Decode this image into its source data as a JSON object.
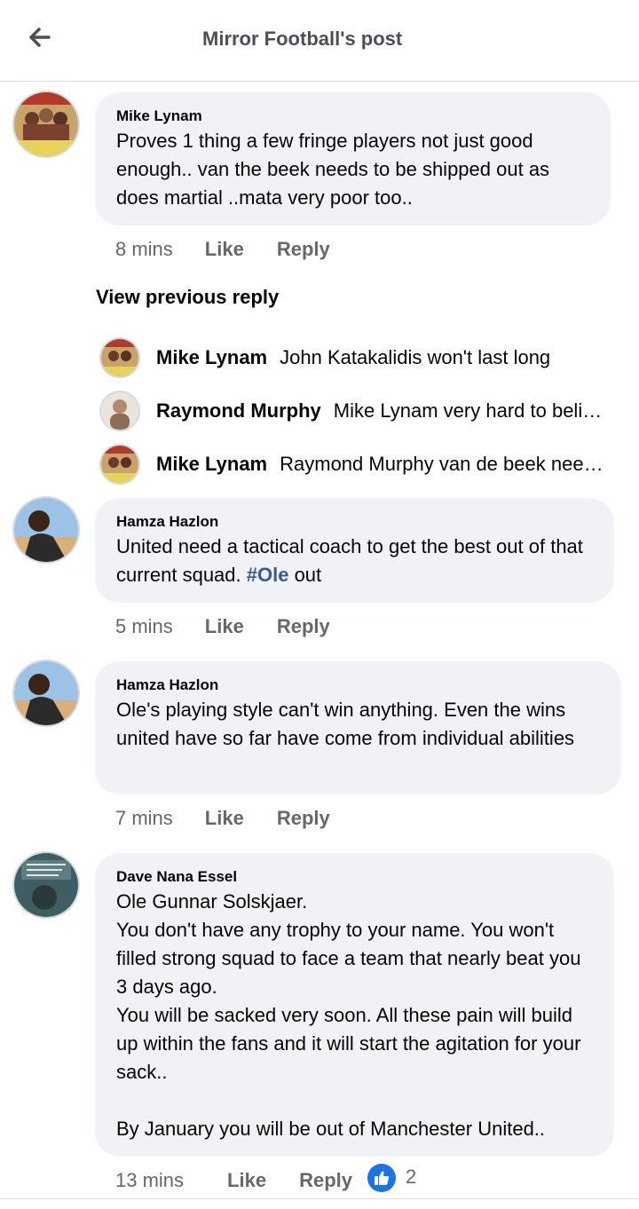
{
  "header": {
    "title": "Mirror Football's post",
    "back_icon": "arrow-left-icon"
  },
  "colors": {
    "bubble": "#f0f2f5",
    "meta": "#65676b",
    "hashtag": "#385898",
    "like_blue": "#1b74e4"
  },
  "comments": [
    {
      "author": "Mike Lynam",
      "text": "Proves 1 thing a few fringe players not just good enough.. van the beek  needs to be shipped out as does martial  ..mata very poor too..",
      "time": "8 mins",
      "like": "Like",
      "reply": "Reply"
    },
    {
      "author": "Hamza Hazlon",
      "text_before": "United need a tactical coach to get the best out of that current squad. ",
      "hashtag": "#Ole",
      "text_after": " out",
      "time": "5 mins",
      "like": "Like",
      "reply": "Reply"
    },
    {
      "author": "Hamza Hazlon",
      "text": "Ole's playing style can't win anything. Even the wins united have so far have come from individual abilities",
      "time": "7 mins",
      "like": "Like",
      "reply": "Reply"
    },
    {
      "author": "Dave Nana Essel",
      "text": "Ole Gunnar Solskjaer.\nYou don't have any trophy to your name. You won't filled strong squad to face a team that nearly beat you 3 days ago.\nYou will be sacked very soon. All these pain will build up within the fans and it will start the agitation for your sack..\n\nBy January you will be out of Manchester United..",
      "time": "13 mins",
      "like": "Like",
      "reply": "Reply",
      "reaction_icon": "thumbs-up-icon",
      "reaction_count": "2"
    }
  ],
  "replies": {
    "view_previous": "View previous reply",
    "items": [
      {
        "author": "Mike Lynam",
        "text": "John Katakalidis   won't last long"
      },
      {
        "author": "Raymond Murphy",
        "text": "Mike Lynam very hard to believe"
      },
      {
        "author": "Mike Lynam",
        "text": "Raymond Murphy  van de beek needs time"
      }
    ]
  }
}
